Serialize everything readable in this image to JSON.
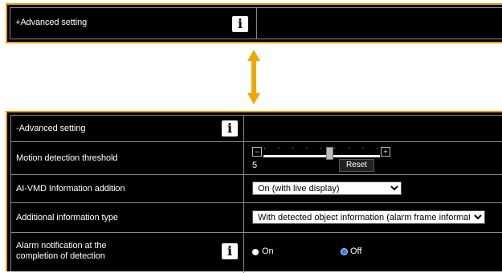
{
  "top_panel": {
    "label": "+Advanced setting",
    "info_icon": "info-icon"
  },
  "bottom_panel": {
    "header_label": "-Advanced setting",
    "motion": {
      "label": "Motion detection threshold",
      "minus": "−",
      "plus": "+",
      "value": "5",
      "reset_label": "Reset",
      "slider_level": 5
    },
    "ai_vmd": {
      "label": "AI-VMD Information addition",
      "selected": "On (with live display)"
    },
    "info_type": {
      "label": "Additional information type",
      "selected": "With detected object information (alarm frame information)"
    },
    "alarm": {
      "label_line1": "Alarm notification at the",
      "label_line2": "completion of detection",
      "on_label": "On",
      "off_label": "Off",
      "selected": "Off"
    }
  },
  "colors": {
    "highlight_border": "#e8a000",
    "arrow": "#f0a800",
    "panel_bg": "#000000"
  }
}
